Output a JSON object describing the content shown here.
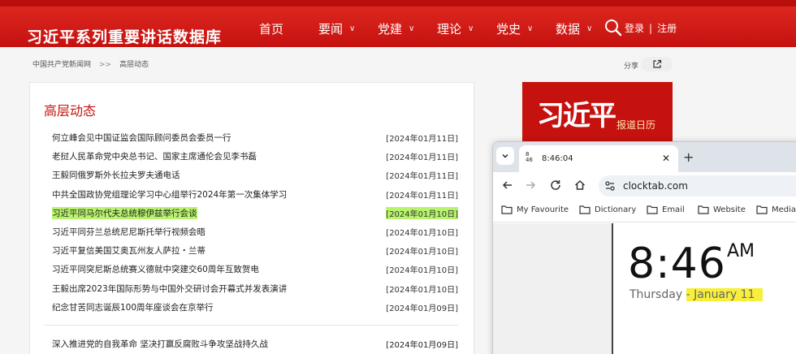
{
  "site": {
    "title": "习近平系列重要讲话数据库",
    "nav": [
      {
        "label": "首页",
        "has_dropdown": false
      },
      {
        "label": "要闻",
        "has_dropdown": true
      },
      {
        "label": "党建",
        "has_dropdown": true
      },
      {
        "label": "理论",
        "has_dropdown": true
      },
      {
        "label": "党史",
        "has_dropdown": true
      },
      {
        "label": "数据",
        "has_dropdown": true
      }
    ],
    "login": "登录",
    "separator": "|",
    "register": "注册"
  },
  "breadcrumb": {
    "home": "中国共产党新闻网",
    "arrow": ">>",
    "current": "高层动态"
  },
  "share": {
    "label": "分享"
  },
  "section": {
    "title": "高层动态"
  },
  "news": [
    {
      "title": "何立峰会见中国证监会国际顾问委员会委员一行",
      "date": "[2024年01月11日]",
      "highlighted": false
    },
    {
      "title": "老挝人民革命党中央总书记、国家主席通伦会见李书磊",
      "date": "[2024年01月11日]",
      "highlighted": false
    },
    {
      "title": "王毅同俄罗斯外长拉夫罗夫通电话",
      "date": "[2024年01月11日]",
      "highlighted": false
    },
    {
      "title": "中共全国政协党组理论学习中心组举行2024年第一次集体学习",
      "date": "[2024年01月11日]",
      "highlighted": false
    },
    {
      "title": "习近平同马尔代夫总统穆伊兹举行会谈",
      "date": "[2024年01月10日]",
      "highlighted": true
    },
    {
      "title": "习近平同芬兰总统尼尼斯托举行视频会晤",
      "date": "[2024年01月10日]",
      "highlighted": false
    },
    {
      "title": "习近平复信美国艾奥瓦州友人萨拉・兰蒂",
      "date": "[2024年01月10日]",
      "highlighted": false
    },
    {
      "title": "习近平同突尼斯总统赛义德就中突建交60周年互致贺电",
      "date": "[2024年01月10日]",
      "highlighted": false
    },
    {
      "title": "王毅出席2023年国际形势与中国外交研讨会开幕式并发表演讲",
      "date": "[2024年01月10日]",
      "highlighted": false
    },
    {
      "title": "纪念甘苦同志诞辰100周年座谈会在京举行",
      "date": "[2024年01月09日]",
      "highlighted": false
    }
  ],
  "news_extra": {
    "title": "深入推进党的自我革命 坚决打赢反腐败斗争攻坚战持久战",
    "date": "[2024年01月09日]"
  },
  "banner": {
    "brush_text": "习近平",
    "caption": "报道日历"
  },
  "browser": {
    "tab_favicon_top": "8",
    "tab_favicon_bottom": "46",
    "tab_title": "8:46:04",
    "url": "clocktab.com",
    "bookmarks": [
      "My Favourite",
      "Dictionary",
      "Email",
      "Website",
      "Media"
    ],
    "clock_time": "8:46",
    "clock_ampm": "AM",
    "weekday": "Thursday",
    "date_dash": "-",
    "date": "January 11"
  },
  "colors": {
    "brand_red": "#c5120f",
    "highlight_green": "#b7f36c",
    "highlight_yellow": "#f7ef3b"
  }
}
